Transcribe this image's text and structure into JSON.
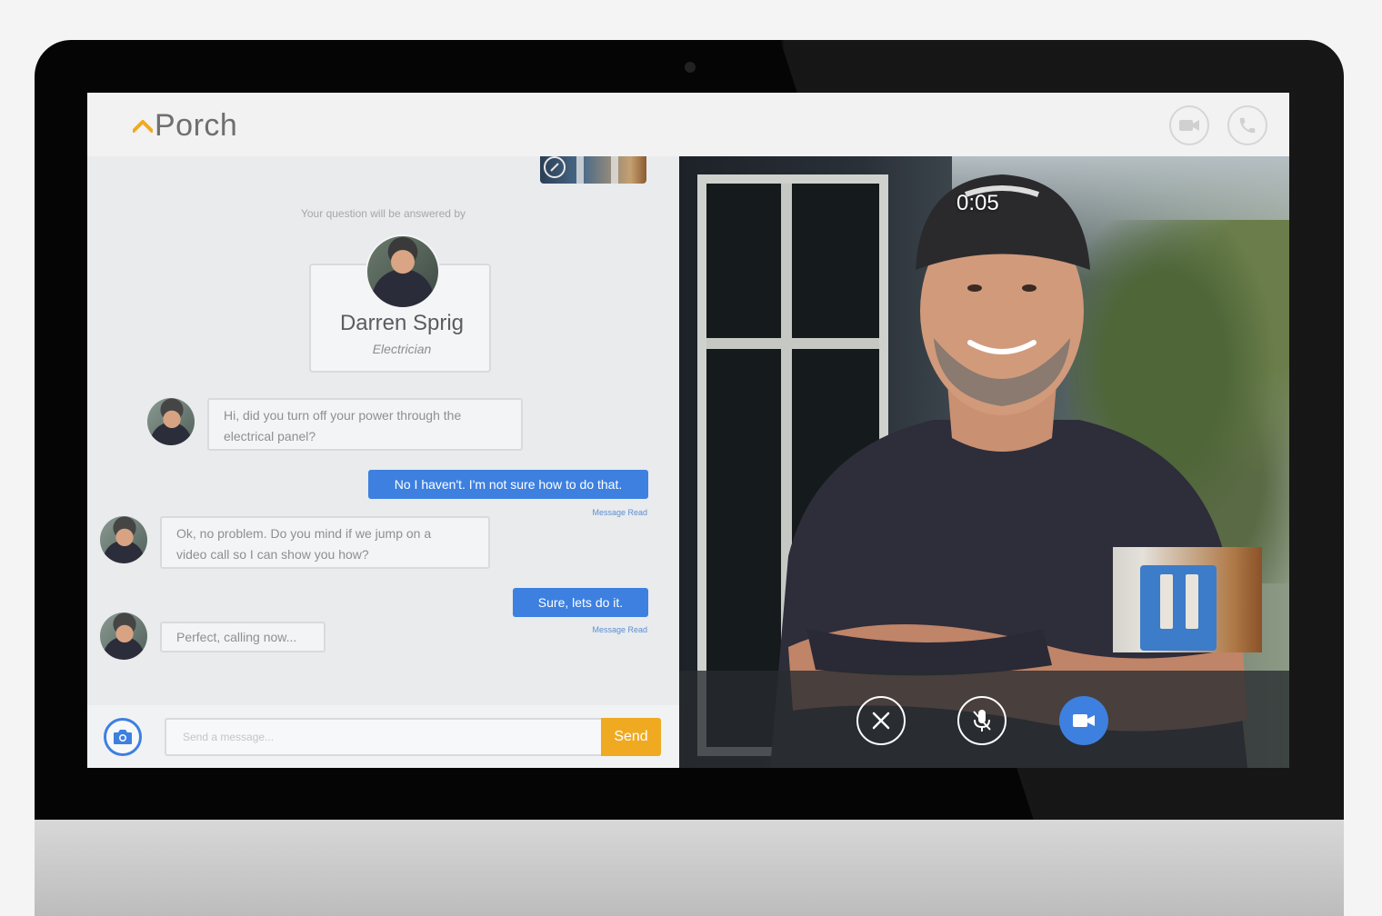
{
  "app": {
    "brand": "Porch",
    "brand_color": "#efaa22",
    "accent": "#3d80e0"
  },
  "topbar": {
    "video_call_icon": "video-camera-icon",
    "phone_call_icon": "phone-icon"
  },
  "chat": {
    "answered_label": "Your question will be answered by",
    "expert": {
      "name": "Darren Sprig",
      "role": "Electrician"
    },
    "messages": [
      {
        "from": "expert",
        "text_lines": [
          "Hi, did you turn off your power through the",
          "electrical panel?"
        ]
      },
      {
        "from": "user",
        "text": "No I haven't. I'm not sure how to do that.",
        "status": "Message Read"
      },
      {
        "from": "expert",
        "text_lines": [
          "Ok, no problem. Do you mind if we jump on a",
          "video call so I can show you how?"
        ]
      },
      {
        "from": "user",
        "text": "Sure, lets do it.",
        "status": "Message Read"
      },
      {
        "from": "expert",
        "text": "Perfect, calling now..."
      }
    ],
    "composer": {
      "placeholder": "Send a message...",
      "send_label": "Send",
      "camera_icon": "camera-icon"
    }
  },
  "video": {
    "timer": "0:05",
    "controls": [
      {
        "icon": "close-icon",
        "action": "end-call"
      },
      {
        "icon": "mic-off-icon",
        "action": "mute"
      },
      {
        "icon": "video-camera-icon",
        "action": "toggle-video",
        "active": true
      }
    ]
  }
}
